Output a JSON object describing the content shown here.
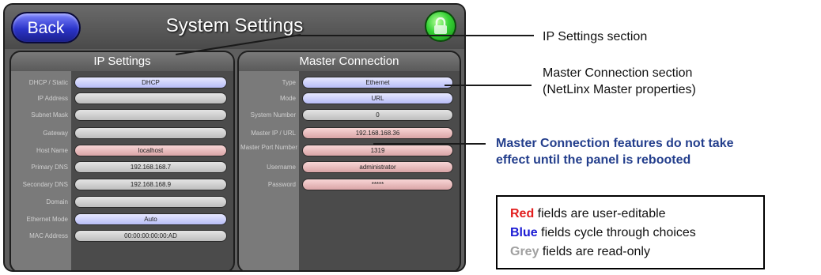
{
  "header": {
    "back_label": "Back",
    "title": "System Settings",
    "lock_icon": "lock-icon"
  },
  "ip_settings": {
    "title": "IP Settings",
    "rows": [
      {
        "label": "DHCP / Static",
        "value": "DHCP",
        "kind": "blue"
      },
      {
        "label": "IP Address",
        "value": "",
        "kind": "grey"
      },
      {
        "label": "Subnet Mask",
        "value": "",
        "kind": "grey"
      },
      {
        "label": "Gateway",
        "value": "",
        "kind": "grey"
      },
      {
        "label": "Host Name",
        "value": "localhost",
        "kind": "red"
      },
      {
        "label": "Primary DNS",
        "value": "192.168.168.7",
        "kind": "grey"
      },
      {
        "label": "Secondary DNS",
        "value": "192.168.168.9",
        "kind": "grey"
      },
      {
        "label": "Domain",
        "value": "",
        "kind": "grey"
      },
      {
        "label": "Ethernet Mode",
        "value": "Auto",
        "kind": "blue"
      },
      {
        "label": "MAC Address",
        "value": "00:00:00:00:00:AD",
        "kind": "grey"
      }
    ]
  },
  "master_connection": {
    "title": "Master Connection",
    "rows": [
      {
        "label": "Type",
        "value": "Ethernet",
        "kind": "blue"
      },
      {
        "label": "Mode",
        "value": "URL",
        "kind": "blue"
      },
      {
        "label": "System Number",
        "value": "0",
        "kind": "grey"
      },
      {
        "label": "Master IP / URL",
        "value": "192.168.168.36",
        "kind": "red"
      },
      {
        "label": "Master Port Number",
        "value": "1319",
        "kind": "red"
      },
      {
        "label": "Username",
        "value": "administrator",
        "kind": "red"
      },
      {
        "label": "Password",
        "value": "*****",
        "kind": "red"
      }
    ]
  },
  "callouts": {
    "ip_section": "IP Settings section",
    "master_section_line1": "Master Connection section",
    "master_section_line2": "(NetLinx Master properties)",
    "reboot_line1": "Master Connection features do not take",
    "reboot_line2": "effect until the panel is rebooted"
  },
  "legend": {
    "red_word": "Red",
    "red_text": " fields are user-editable",
    "blue_word": "Blue",
    "blue_text": " fields cycle through choices",
    "grey_word": "Grey",
    "grey_text": " fields are read-only"
  },
  "colors": {
    "blue_field": "#b8bdf6",
    "red_field": "#d9a4a6",
    "grey_field": "#bdbdbd",
    "legend_red": "#e21d1d",
    "legend_blue": "#1b1bd4",
    "legend_grey": "#a0a0a0",
    "callout_bold": "#233e8c"
  }
}
